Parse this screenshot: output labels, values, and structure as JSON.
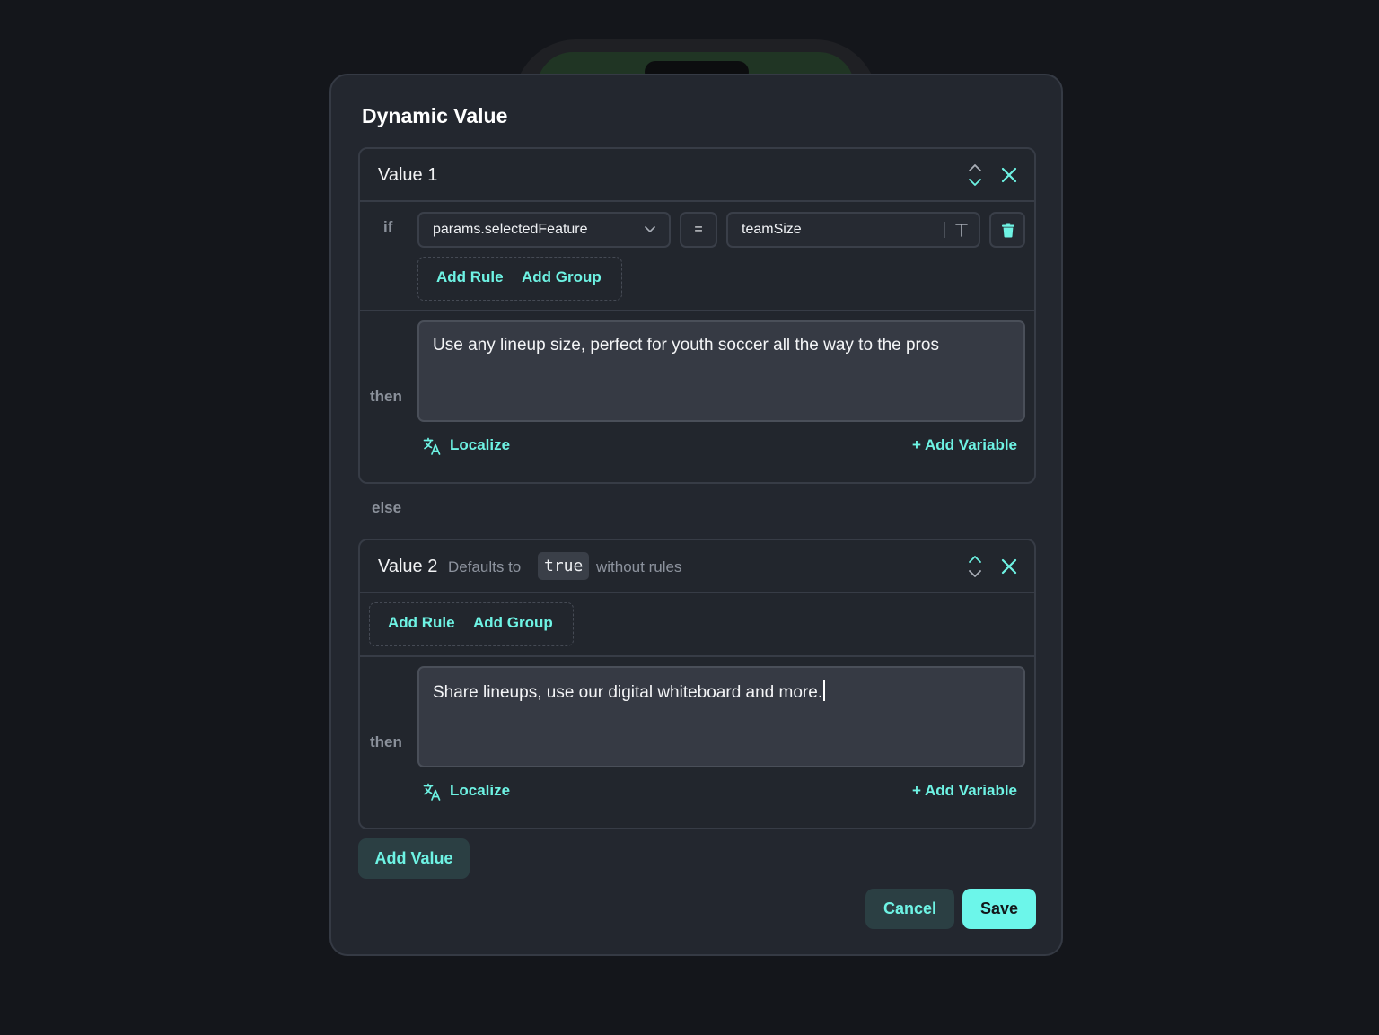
{
  "modal": {
    "title": "Dynamic Value",
    "else_label": "else",
    "add_value_label": "Add Value",
    "cancel_label": "Cancel",
    "save_label": "Save"
  },
  "value1": {
    "name": "Value 1",
    "if_label": "if",
    "then_label": "then",
    "rule": {
      "field": "params.selectedFeature",
      "operator": "=",
      "value": "teamSize"
    },
    "add_rule_label": "Add Rule",
    "add_group_label": "Add Group",
    "text": "Use any lineup size, perfect for youth soccer all the way to the pros",
    "localize_label": "Localize",
    "add_variable_label": "+ Add Variable"
  },
  "value2": {
    "name": "Value 2",
    "defaults_to_label": "Defaults to",
    "default_value": "true",
    "without_rules_label": "without rules",
    "then_label": "then",
    "add_rule_label": "Add Rule",
    "add_group_label": "Add Group",
    "text": "Share lineups, use our digital whiteboard and more.",
    "localize_label": "Localize",
    "add_variable_label": "+ Add Variable"
  },
  "colors": {
    "accent": "#6ef3e4",
    "background": "#14161b",
    "modal_bg": "#23272f"
  },
  "icons": [
    "reorder-icon",
    "close-icon",
    "chevron-down-icon",
    "text-type-icon",
    "trash-icon",
    "translate-icon"
  ]
}
